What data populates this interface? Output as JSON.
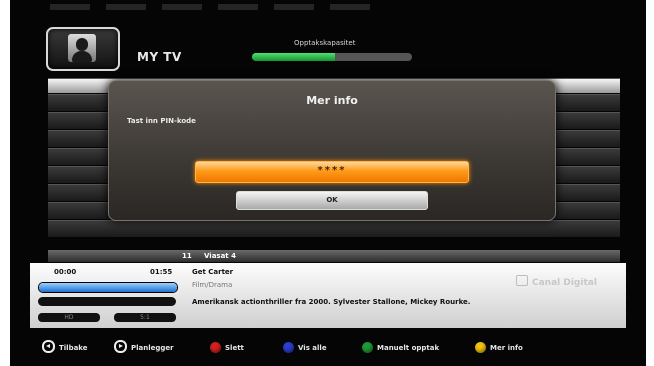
{
  "header": {
    "title": "MY TV",
    "recording_capacity_label": "Opptakskapasitet",
    "recording_capacity_fraction": 0.52
  },
  "dialog": {
    "title": "Mer info",
    "prompt": "Tast inn PIN-kode",
    "pin_value": "****",
    "ok_label": "OK"
  },
  "channel": {
    "number": "11",
    "name": "Viasat 4"
  },
  "program": {
    "start_time": "00:00",
    "end_time": "01:55",
    "title": "Get Carter",
    "genre": "Film/Drama",
    "description": "Amerikansk actionthriller fra 2000. Sylvester Stallone, Mickey Rourke.",
    "progress_fraction": 1.0,
    "badges": [
      "HD",
      "5:1"
    ],
    "provider": "Canal Digital"
  },
  "footer": {
    "items": [
      {
        "label": "Tilbake",
        "icon": "back-ring-icon",
        "color": "#eeeeee"
      },
      {
        "label": "Planlegger",
        "icon": "forward-ring-icon",
        "color": "#eeeeee"
      },
      {
        "label": "Slett",
        "icon": "red-button-icon",
        "color": "#d62020"
      },
      {
        "label": "Vis alle",
        "icon": "blue-button-icon",
        "color": "#2a3fd0"
      },
      {
        "label": "Manuelt opptak",
        "icon": "green-button-icon",
        "color": "#1f9a34"
      },
      {
        "label": "Mer info",
        "icon": "yellow-button-icon",
        "color": "#f2c20f"
      }
    ]
  },
  "colors": {
    "accent_orange": "#ff9a18",
    "progress_blue": "#1e70d0",
    "capacity_green": "#24b043"
  }
}
